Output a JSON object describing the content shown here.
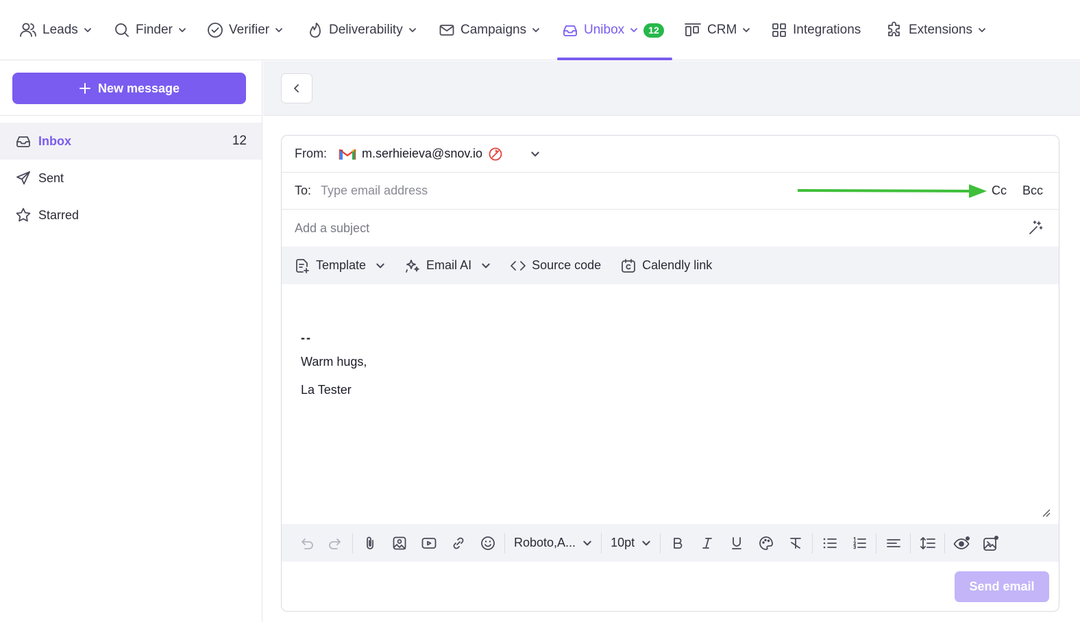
{
  "nav": {
    "items": [
      {
        "label": "Leads",
        "icon": "users-icon"
      },
      {
        "label": "Finder",
        "icon": "search-icon"
      },
      {
        "label": "Verifier",
        "icon": "check-circle-icon"
      },
      {
        "label": "Deliverability",
        "icon": "flame-icon"
      },
      {
        "label": "Campaigns",
        "icon": "mail-icon"
      },
      {
        "label": "Unibox",
        "icon": "inbox-icon",
        "badge": "12",
        "active": true
      },
      {
        "label": "CRM",
        "icon": "crm-icon"
      },
      {
        "label": "Integrations",
        "icon": "grid-icon"
      },
      {
        "label": "Extensions",
        "icon": "puzzle-icon"
      }
    ],
    "accent": "#7a5cf0",
    "badge_color": "#27b84a"
  },
  "sidebar": {
    "new_message": "New message",
    "items": [
      {
        "label": "Inbox",
        "count": "12",
        "icon": "inbox-icon",
        "active": true
      },
      {
        "label": "Sent",
        "icon": "send-icon"
      },
      {
        "label": "Starred",
        "icon": "star-icon"
      }
    ]
  },
  "compose": {
    "from_label": "From:",
    "from_email": "m.serhieieva@snov.io",
    "to_label": "To:",
    "to_placeholder": "Type email address",
    "cc": "Cc",
    "bcc": "Bcc",
    "subject_placeholder": "Add a subject",
    "toolbar_top": {
      "template": "Template",
      "email_ai": "Email AI",
      "source_code": "Source code",
      "calendly": "Calendly link"
    },
    "body": {
      "dash": "--",
      "line1": "Warm hugs,",
      "line2": "La Tester"
    },
    "toolbar_bottom": {
      "font": "Roboto,A...",
      "size": "10pt"
    },
    "send": "Send email",
    "send_color": "#c3b5f8"
  },
  "annotation": {
    "arrow_color": "#3fbf3a"
  }
}
